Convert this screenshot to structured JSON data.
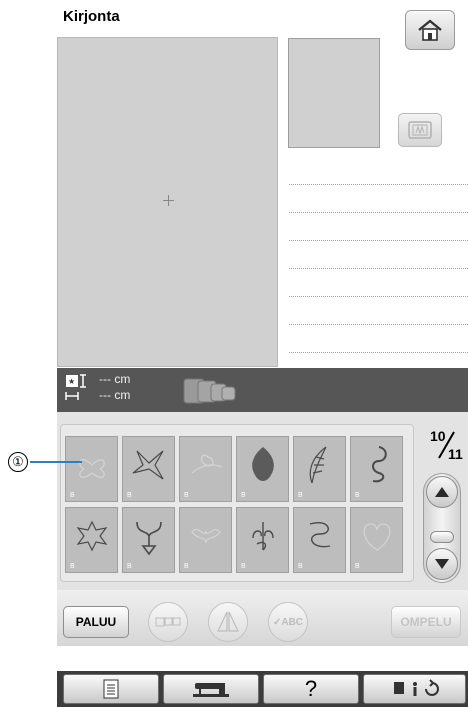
{
  "header": {
    "title": "Kirjonta"
  },
  "info": {
    "width_value": "--- cm",
    "height_value": "--- cm"
  },
  "patterns": {
    "page_current": "10",
    "page_total": "11",
    "tile_tag": "B",
    "tiles": [
      {
        "name": "butterfly-pattern",
        "state": "disabled"
      },
      {
        "name": "dragonfly-pattern",
        "state": "enabled"
      },
      {
        "name": "bird-branch-pattern",
        "state": "disabled"
      },
      {
        "name": "damask-ornament-pattern",
        "state": "enabled"
      },
      {
        "name": "feather-pattern",
        "state": "enabled"
      },
      {
        "name": "paisley-scroll-pattern",
        "state": "enabled"
      },
      {
        "name": "flower-pattern",
        "state": "enabled"
      },
      {
        "name": "heart-scroll-pattern",
        "state": "enabled"
      },
      {
        "name": "swirl-pattern",
        "state": "disabled"
      },
      {
        "name": "scroll-flourish-pattern",
        "state": "enabled"
      },
      {
        "name": "knot-pattern",
        "state": "enabled"
      },
      {
        "name": "heart-pattern",
        "state": "disabled"
      }
    ]
  },
  "callout": {
    "number": "①"
  },
  "actions": {
    "back_label": "PALUU",
    "abc_label": "✓ABC",
    "sew_label": "OMPELU"
  },
  "colors": {
    "accent": "#2c7fc4",
    "dark_strip": "#565656",
    "panel": "#e3e3e3"
  }
}
